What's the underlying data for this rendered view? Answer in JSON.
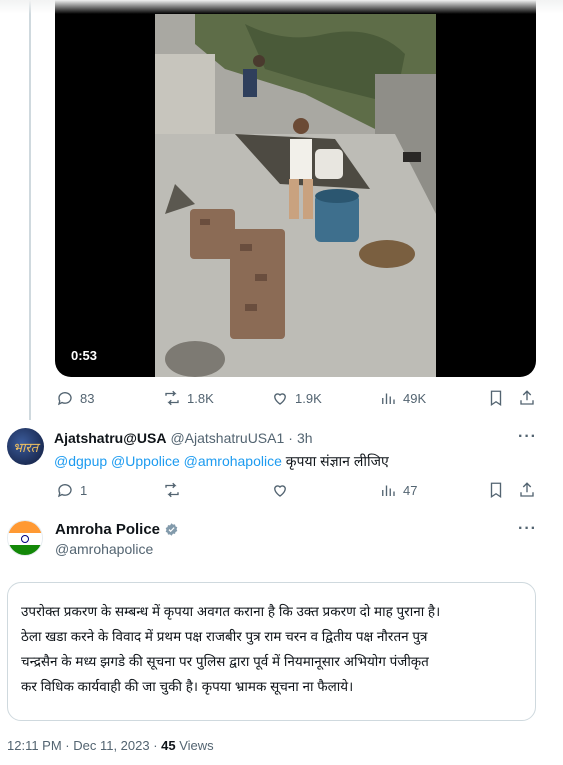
{
  "video": {
    "duration": "0:53"
  },
  "tweet_actions": {
    "replies": "83",
    "reposts": "1.8K",
    "likes": "1.9K",
    "views": "49K"
  },
  "reply": {
    "avatar_text": "भारत",
    "name": "Ajatshatru@USA",
    "handle": "@AjatshatruUSA1",
    "separator": "·",
    "time": "3h",
    "mentions": [
      "@dgpup",
      "@Uppolice",
      "@amrohapolice"
    ],
    "text": "कृपया संज्ञान लीजिए",
    "actions": {
      "replies": "1",
      "views": "47"
    }
  },
  "main_tweet": {
    "name": "Amroha Police",
    "handle": "@amrohapolice",
    "lines": [
      "उपरोक्त प्रकरण के सम्बन्ध में कृपया अवगत कराना है कि उक्त प्रकरण दो माह पुराना है।",
      "ठेला खडा करने के विवाद में प्रथम पक्ष राजबीर पुत्र राम चरन व द्वितीय पक्ष नौरतन पुत्र",
      "चन्द्रसैन के मध्य झगडे की सूचना पर पुलिस द्वारा पूर्व में नियमानूसार अभियोग पंजीकृत",
      "कर विधिक कार्यवाही की जा चुकी है। कृपया भ्रामक सूचना ना फैलाये।"
    ],
    "timestamp": "12:11 PM · Dec 11, 2023 · ",
    "views_count": "45",
    "views_label": " Views"
  },
  "colors": {
    "accent": "#1d9bf0",
    "muted": "#536471",
    "verified": "#829aab"
  }
}
